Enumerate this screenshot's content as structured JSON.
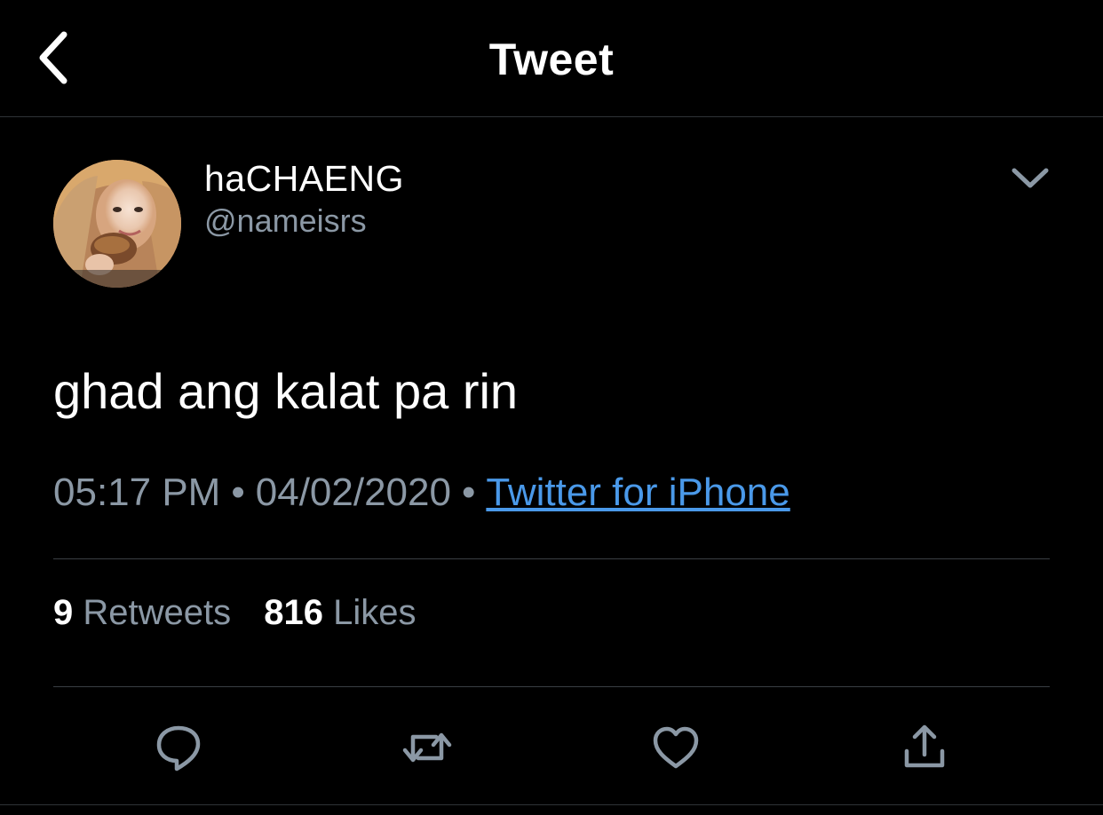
{
  "header": {
    "title": "Tweet",
    "back_icon": "chevron-left-icon"
  },
  "author": {
    "display_name": "haCHAENG",
    "handle": "@nameisrs",
    "menu_icon": "chevron-down-icon"
  },
  "tweet": {
    "text": "ghad ang kalat pa rin",
    "time": "05:17 PM",
    "date": "04/02/2020",
    "separator": "•",
    "source": "Twitter for iPhone"
  },
  "stats": {
    "retweets_count": "9",
    "retweets_label": "Retweets",
    "likes_count": "816",
    "likes_label": "Likes"
  },
  "actions": {
    "reply_icon": "reply-icon",
    "retweet_icon": "retweet-icon",
    "like_icon": "heart-icon",
    "share_icon": "share-icon"
  },
  "colors": {
    "background": "#000000",
    "primary_text": "#ffffff",
    "secondary_text": "#8b98a5",
    "link": "#4a99e9",
    "divider": "#3a3f44"
  }
}
